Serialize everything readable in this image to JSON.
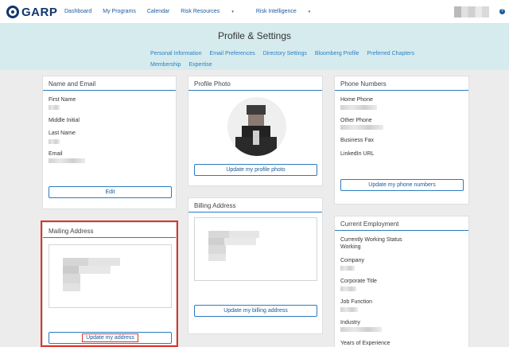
{
  "brand": {
    "name": "GARP"
  },
  "nav": {
    "items": [
      {
        "label": "Dashboard"
      },
      {
        "label": "My Programs"
      },
      {
        "label": "Calendar"
      },
      {
        "label": "Risk Resources",
        "caret": "▾"
      },
      {
        "label": "Risk Intelligence",
        "caret": "▾"
      }
    ],
    "help": "?"
  },
  "hero": {
    "title": "Profile & Settings"
  },
  "subnav": {
    "row1": [
      "Personal Information",
      "Email Preferences",
      "Directory Settings",
      "Bloomberg Profile",
      "Preferred Chapters"
    ],
    "row2": [
      "Membership",
      "Expertise"
    ]
  },
  "name_email": {
    "title": "Name and Email",
    "first_name": "First Name",
    "middle_initial": "Middle Initial",
    "last_name": "Last Name",
    "email": "Email",
    "edit": "Edit"
  },
  "mailing": {
    "title": "Mailing Address",
    "update": "Update my address"
  },
  "photo": {
    "title": "Profile Photo",
    "update": "Update my profile photo"
  },
  "billing": {
    "title": "Billing Address",
    "update": "Update my billing address"
  },
  "phones": {
    "title": "Phone Numbers",
    "home": "Home Phone",
    "other": "Other Phone",
    "fax": "Business Fax",
    "linkedin": "LinkedIn URL",
    "update": "Update my phone numbers"
  },
  "employment": {
    "title": "Current Employment",
    "status_label": "Currently Working Status",
    "status_value": "Working",
    "company": "Company",
    "corp_title": "Corporate Title",
    "job_function": "Job Function",
    "industry": "Industry",
    "years": "Years of Experience"
  },
  "colors": {
    "accent": "#2c7bbf",
    "highlight": "#e0352b",
    "hero": "#d6ebee"
  }
}
